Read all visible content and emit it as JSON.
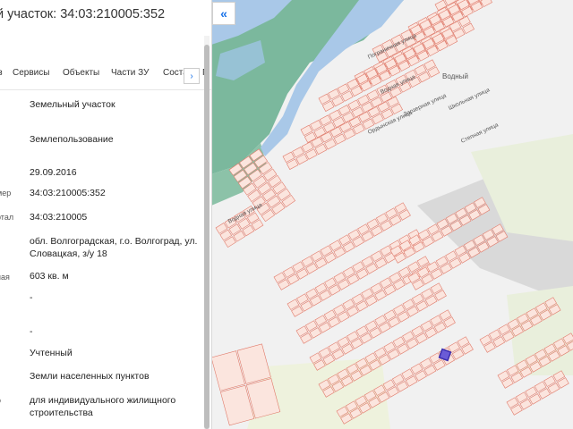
{
  "panel": {
    "title": "й участок: 34:03:210005:352",
    "tabs": [
      "з",
      "Сервисы",
      "Объекты",
      "Части ЗУ",
      "Соста",
      "Г"
    ],
    "rows": [
      {
        "label": "",
        "value": "Земельный участок"
      },
      {
        "label": "",
        "value": "Землепользование"
      },
      {
        "label": "",
        "value": "29.09.2016"
      },
      {
        "label": "мер",
        "value": "34:03:210005:352"
      },
      {
        "label": "ртал",
        "value": "34:03:210005"
      },
      {
        "label": "",
        "value": "обл. Волгоградская, г.о. Волгоград, ул. Словацкая, з/у 18"
      },
      {
        "label": "ная",
        "value": "603 кв. м"
      },
      {
        "label": "",
        "value": "-"
      },
      {
        "label": "",
        "value": "-"
      },
      {
        "label": "",
        "value": "Учтенный"
      },
      {
        "label": "",
        "value": "Земли населенных пунктов"
      },
      {
        "label": "о",
        "value": "для индивидуального жилищного строительства"
      }
    ]
  },
  "map": {
    "streets": [
      "Пограничная улица",
      "Водная улица",
      "Ордынская улица",
      "Заозерная улица",
      "Школьная улица",
      "Степная улица",
      "Водная улица"
    ],
    "district": "Водный",
    "colors": {
      "water": "#a9c8e8",
      "forest": "#76b59b",
      "parcel": "#fbe5de",
      "parcel_stroke": "#e07a6a",
      "road": "#dcdcdc",
      "selected": "#6b5bd6"
    }
  },
  "icons": {
    "collapse": "«",
    "tab_next": "›"
  }
}
